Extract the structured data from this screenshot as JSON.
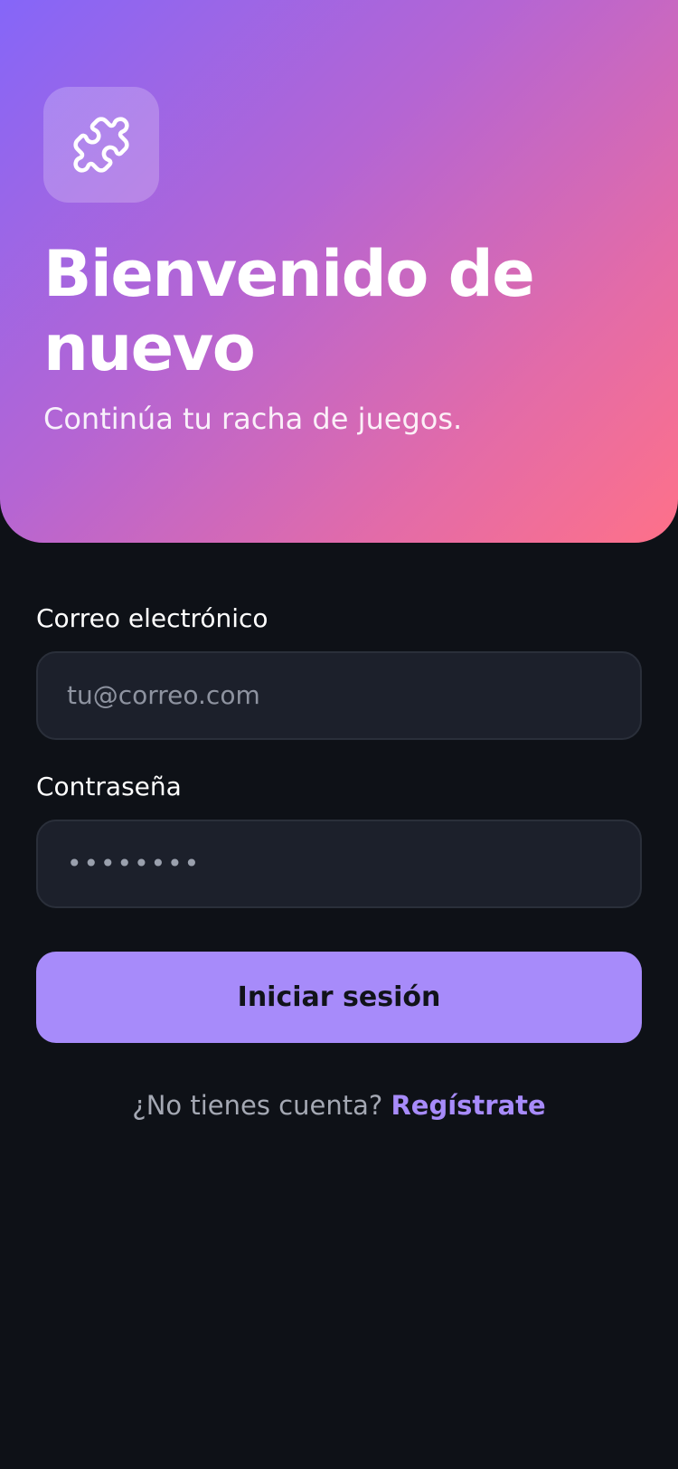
{
  "header": {
    "logo_icon": "puzzle-icon",
    "title_line1": "Bienvenido de",
    "title_line2": "nuevo",
    "subtitle": "Continúa tu racha de juegos."
  },
  "form": {
    "email_label": "Correo electrónico",
    "email_placeholder": "tu@correo.com",
    "password_label": "Contraseña",
    "password_value": "••••••••",
    "submit_label": "Iniciar sesión"
  },
  "footer": {
    "prompt": "¿No tienes cuenta?",
    "link_label": "Regístrate"
  },
  "colors": {
    "gradient_start": "#8566f8",
    "gradient_end": "#fe7189",
    "accent": "#a78bfa",
    "background": "#0e1117",
    "input_background": "#1c202b"
  }
}
